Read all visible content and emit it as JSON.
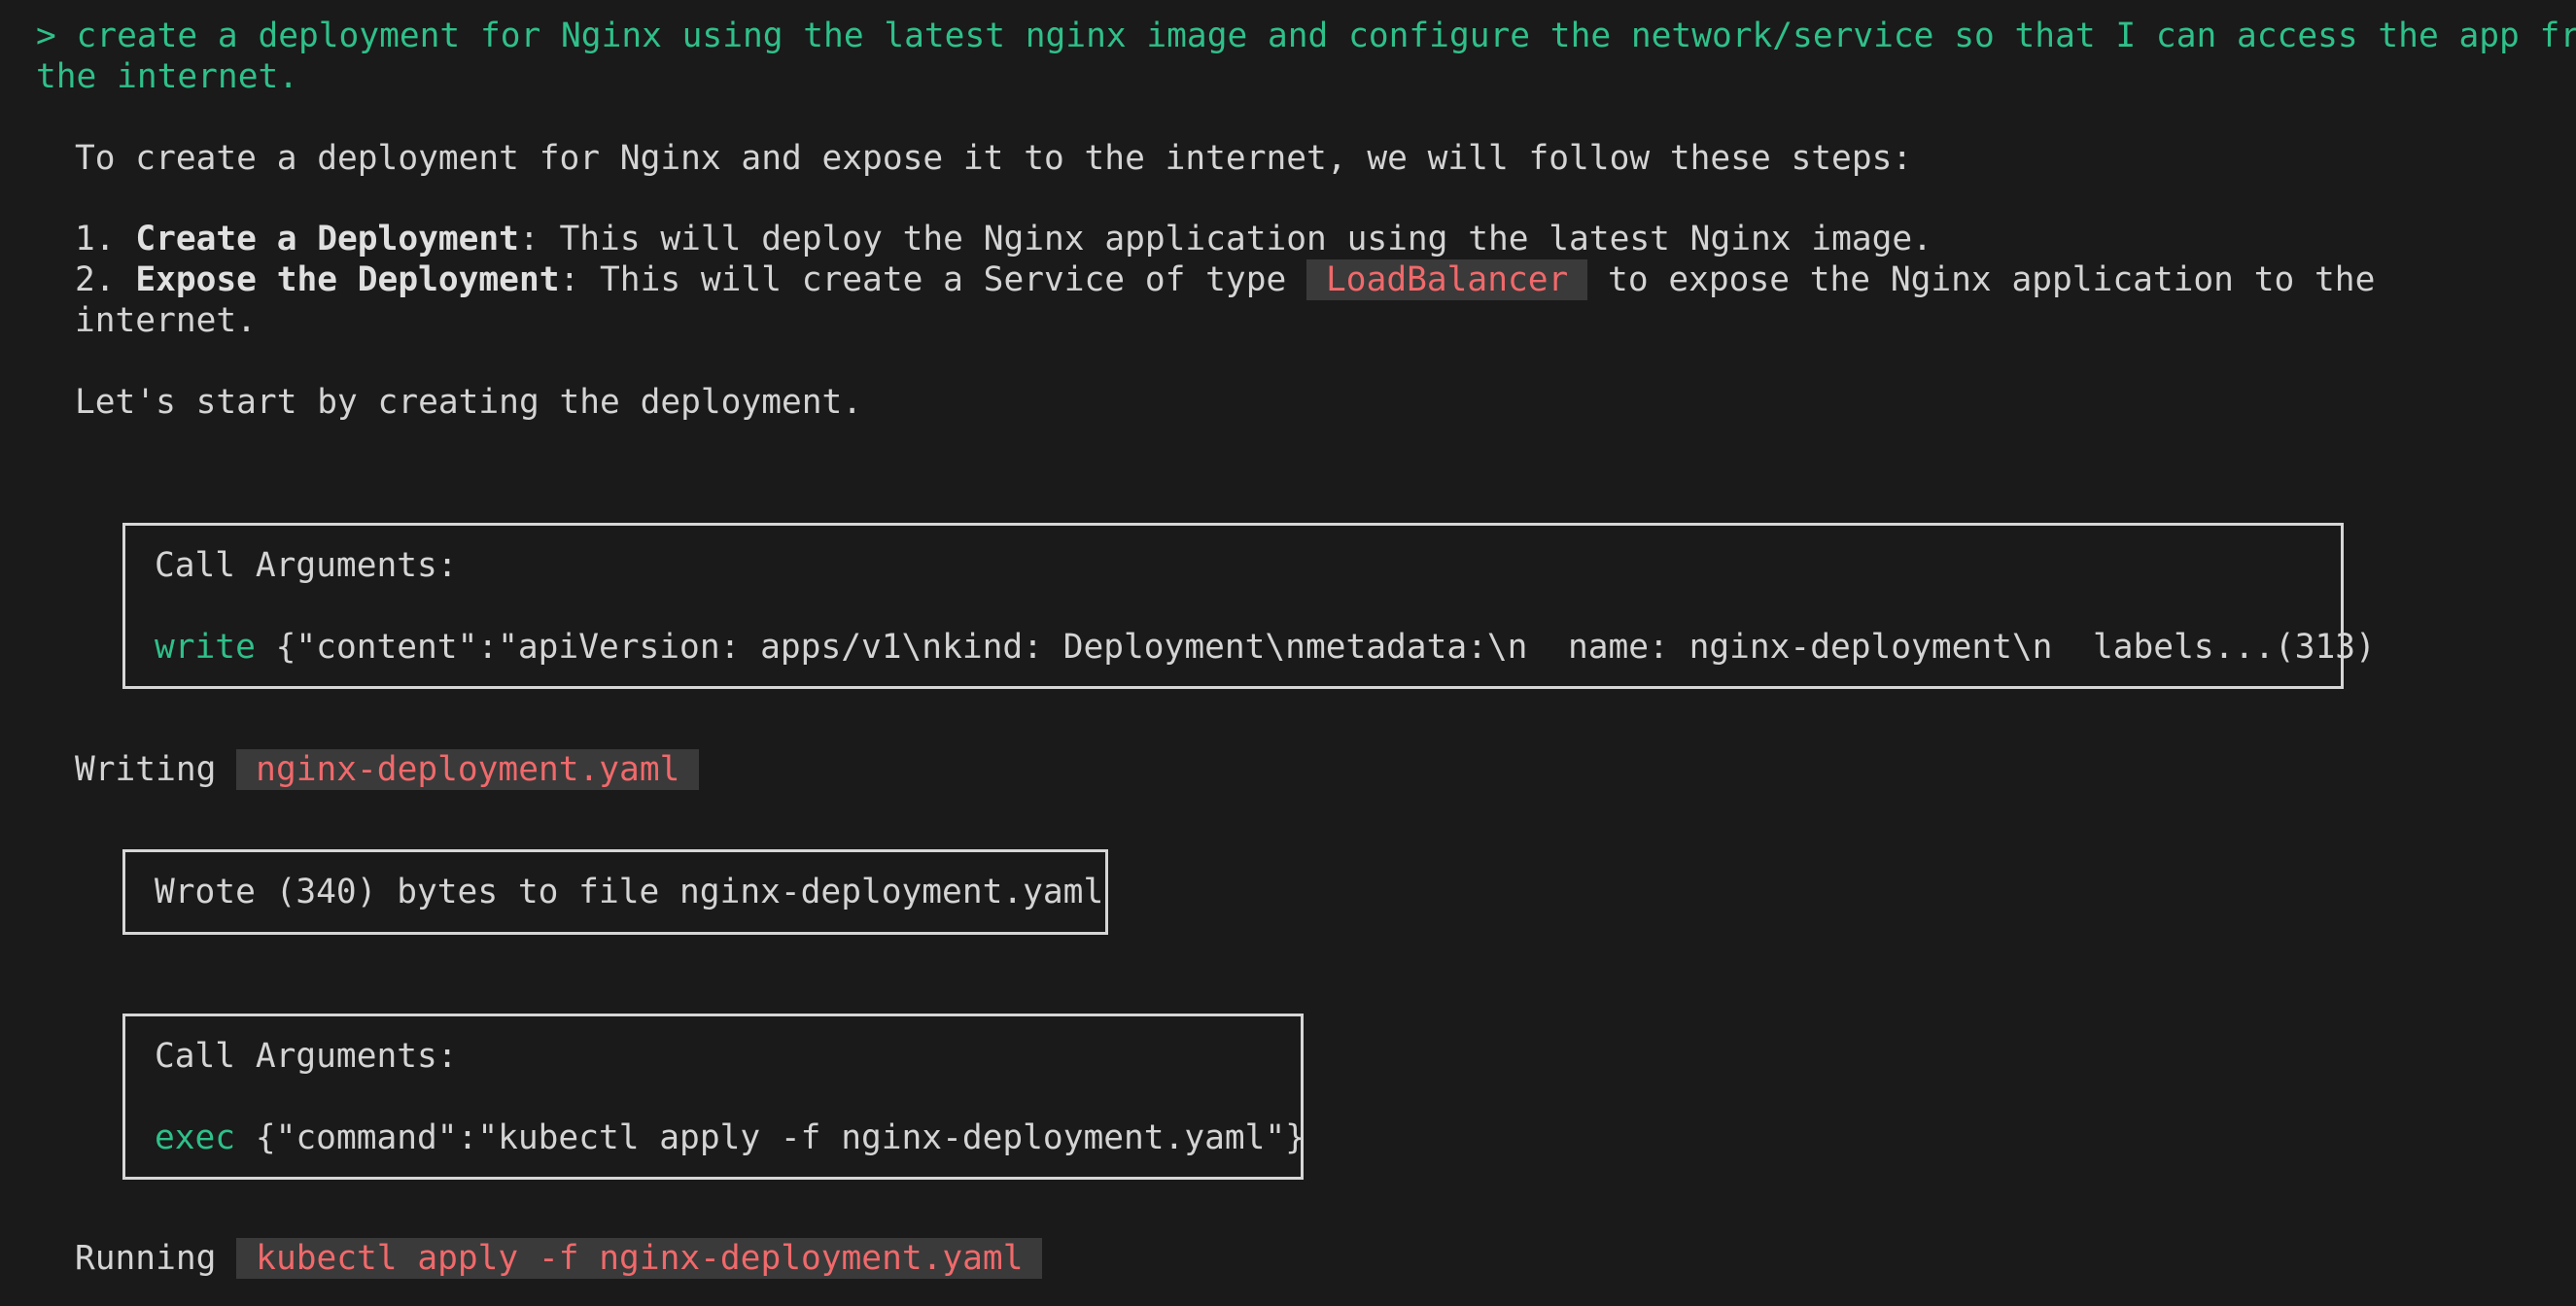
{
  "prompt": {
    "line1": "> create a deployment for Nginx using the latest nginx image and configure the network/service so that I can access the app from",
    "line2": "the internet."
  },
  "response": {
    "intro": "To create a deployment for Nginx and expose it to the internet, we will follow these steps:",
    "step1": {
      "number": "1. ",
      "title": "Create a Deployment",
      "text": ": This will deploy the Nginx application using the latest Nginx image."
    },
    "step2": {
      "number": "2. ",
      "title": "Expose the Deployment",
      "text_before": ": This will create a Service of type ",
      "code": "LoadBalancer",
      "text_after": " to expose the Nginx application to the",
      "continuation": "internet."
    },
    "start": "Let's start by creating the deployment."
  },
  "call1": {
    "header": "Call Arguments:",
    "tool": "write",
    "args": " {\"content\":\"apiVersion: apps/v1\\nkind: Deployment\\nmetadata:\\n  name: nginx-deployment\\n  labels...(313)"
  },
  "writing": {
    "label": "Writing ",
    "file": "nginx-deployment.yaml"
  },
  "result1": {
    "text": "Wrote (340) bytes to file nginx-deployment.yaml"
  },
  "call2": {
    "header": "Call Arguments:",
    "tool": "exec",
    "args": " {\"command\":\"kubectl apply -f nginx-deployment.yaml\"}"
  },
  "running": {
    "label": "Running ",
    "command": "kubectl apply -f nginx-deployment.yaml"
  }
}
